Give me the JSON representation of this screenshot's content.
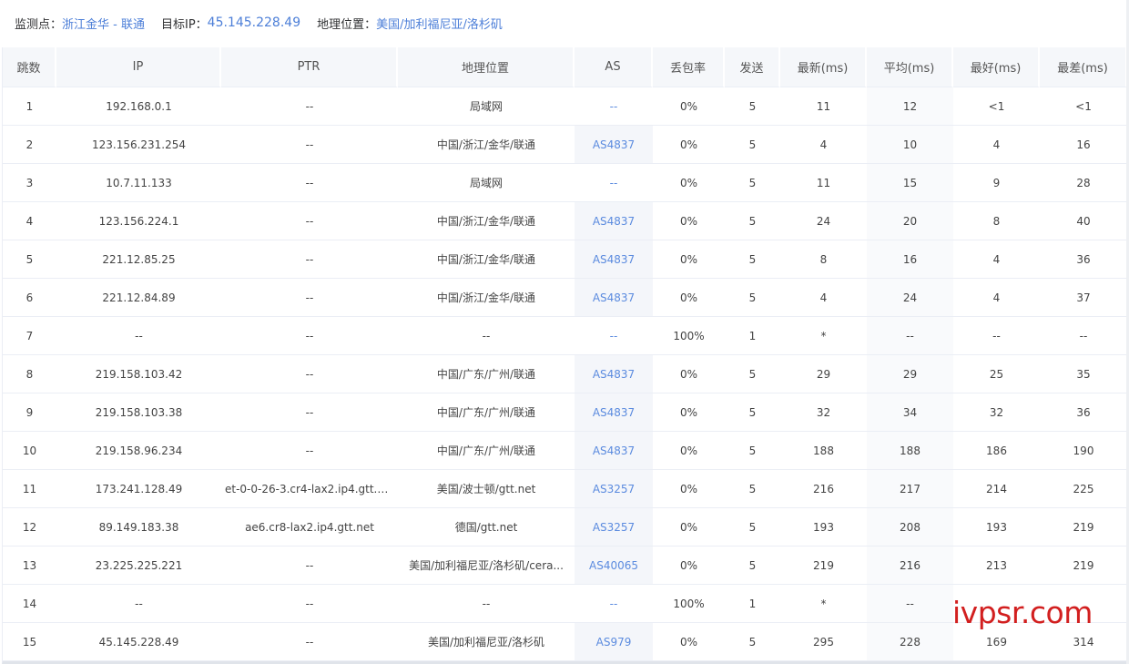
{
  "header": {
    "probe_label": "监测点：",
    "probe_value": "浙江金华 - 联通",
    "target_label": "目标IP：",
    "target_value": "45.145.228.49",
    "geo_label": "地理位置：",
    "geo_value": "美国/加利福尼亚/洛杉矶"
  },
  "columns": [
    "跳数",
    "IP",
    "PTR",
    "地理位置",
    "AS",
    "丢包率",
    "发送",
    "最新(ms)",
    "平均(ms)",
    "最好(ms)",
    "最差(ms)"
  ],
  "rows": [
    {
      "hop": "1",
      "ip": "192.168.0.1",
      "ptr": "--",
      "geo": "局域网",
      "as": "--",
      "loss": "0%",
      "sent": "5",
      "last": "11",
      "avg": "12",
      "best": "<1",
      "worst": "<1"
    },
    {
      "hop": "2",
      "ip": "123.156.231.254",
      "ptr": "--",
      "geo": "中国/浙江/金华/联通",
      "as": "AS4837",
      "loss": "0%",
      "sent": "5",
      "last": "4",
      "avg": "10",
      "best": "4",
      "worst": "16"
    },
    {
      "hop": "3",
      "ip": "10.7.11.133",
      "ptr": "--",
      "geo": "局域网",
      "as": "--",
      "loss": "0%",
      "sent": "5",
      "last": "11",
      "avg": "15",
      "best": "9",
      "worst": "28"
    },
    {
      "hop": "4",
      "ip": "123.156.224.1",
      "ptr": "--",
      "geo": "中国/浙江/金华/联通",
      "as": "AS4837",
      "loss": "0%",
      "sent": "5",
      "last": "24",
      "avg": "20",
      "best": "8",
      "worst": "40"
    },
    {
      "hop": "5",
      "ip": "221.12.85.25",
      "ptr": "--",
      "geo": "中国/浙江/金华/联通",
      "as": "AS4837",
      "loss": "0%",
      "sent": "5",
      "last": "8",
      "avg": "16",
      "best": "4",
      "worst": "36"
    },
    {
      "hop": "6",
      "ip": "221.12.84.89",
      "ptr": "--",
      "geo": "中国/浙江/金华/联通",
      "as": "AS4837",
      "loss": "0%",
      "sent": "5",
      "last": "4",
      "avg": "24",
      "best": "4",
      "worst": "37"
    },
    {
      "hop": "7",
      "ip": "--",
      "ptr": "--",
      "geo": "--",
      "as": "--",
      "loss": "100%",
      "sent": "1",
      "last": "*",
      "avg": "--",
      "best": "--",
      "worst": "--"
    },
    {
      "hop": "8",
      "ip": "219.158.103.42",
      "ptr": "--",
      "geo": "中国/广东/广州/联通",
      "as": "AS4837",
      "loss": "0%",
      "sent": "5",
      "last": "29",
      "avg": "29",
      "best": "25",
      "worst": "35"
    },
    {
      "hop": "9",
      "ip": "219.158.103.38",
      "ptr": "--",
      "geo": "中国/广东/广州/联通",
      "as": "AS4837",
      "loss": "0%",
      "sent": "5",
      "last": "32",
      "avg": "34",
      "best": "32",
      "worst": "36"
    },
    {
      "hop": "10",
      "ip": "219.158.96.234",
      "ptr": "--",
      "geo": "中国/广东/广州/联通",
      "as": "AS4837",
      "loss": "0%",
      "sent": "5",
      "last": "188",
      "avg": "188",
      "best": "186",
      "worst": "190"
    },
    {
      "hop": "11",
      "ip": "173.241.128.49",
      "ptr": "et-0-0-26-3.cr4-lax2.ip4.gtt.n...",
      "geo": "美国/波士顿/gtt.net",
      "as": "AS3257",
      "loss": "0%",
      "sent": "5",
      "last": "216",
      "avg": "217",
      "best": "214",
      "worst": "225"
    },
    {
      "hop": "12",
      "ip": "89.149.183.38",
      "ptr": "ae6.cr8-lax2.ip4.gtt.net",
      "geo": "德国/gtt.net",
      "as": "AS3257",
      "loss": "0%",
      "sent": "5",
      "last": "193",
      "avg": "208",
      "best": "193",
      "worst": "219"
    },
    {
      "hop": "13",
      "ip": "23.225.225.221",
      "ptr": "--",
      "geo": "美国/加利福尼亚/洛杉矶/cera...",
      "as": "AS40065",
      "loss": "0%",
      "sent": "5",
      "last": "219",
      "avg": "216",
      "best": "213",
      "worst": "219"
    },
    {
      "hop": "14",
      "ip": "--",
      "ptr": "--",
      "geo": "--",
      "as": "--",
      "loss": "100%",
      "sent": "1",
      "last": "*",
      "avg": "--",
      "best": "",
      "worst": ""
    },
    {
      "hop": "15",
      "ip": "45.145.228.49",
      "ptr": "--",
      "geo": "美国/加利福尼亚/洛杉矶",
      "as": "AS979",
      "loss": "0%",
      "sent": "5",
      "last": "295",
      "avg": "228",
      "best": "169",
      "worst": "314"
    }
  ],
  "watermark": "ivpsr.com",
  "colors": {
    "link": "#4d7fd8",
    "header_bg": "#f5f7fa",
    "watermark": "#d21f1f"
  }
}
